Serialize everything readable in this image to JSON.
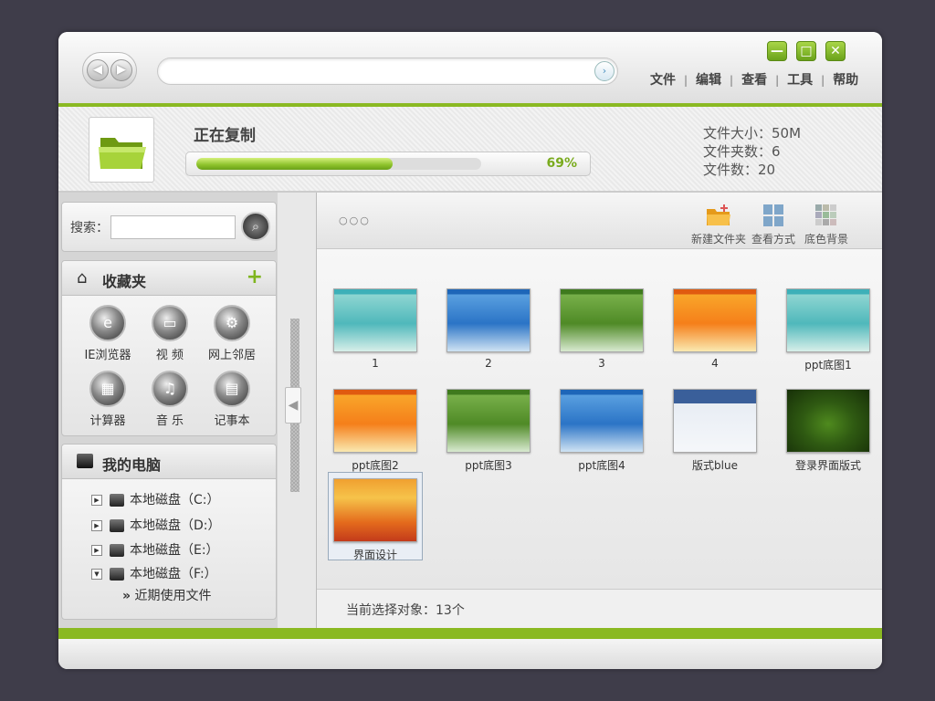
{
  "menu": {
    "file": "文件",
    "edit": "编辑",
    "view": "查看",
    "tools": "工具",
    "help": "帮助"
  },
  "window_controls": {
    "minimize": "—",
    "maximize": "□",
    "close": "✕"
  },
  "copy": {
    "title": "正在复制",
    "progress_pct": 0.69,
    "progress_label": "69%",
    "stats": {
      "size": "文件大小：50M",
      "folders": "文件夹数：6",
      "files": "文件数：20"
    }
  },
  "search": {
    "label": "搜索："
  },
  "favorites": {
    "title": "收藏夹",
    "items": [
      {
        "label": "IE浏览器",
        "icon": "ie-icon"
      },
      {
        "label": "视 频",
        "icon": "video-icon"
      },
      {
        "label": "网上邻居",
        "icon": "network-icon"
      },
      {
        "label": "计算器",
        "icon": "calculator-icon"
      },
      {
        "label": "音 乐",
        "icon": "music-icon"
      },
      {
        "label": "记事本",
        "icon": "notepad-icon"
      }
    ]
  },
  "computer": {
    "title": "我的电脑",
    "drives": [
      "本地磁盘（C:）",
      "本地磁盘（D:）",
      "本地磁盘（E:）",
      "本地磁盘（F:）"
    ],
    "recent": "近期使用文件"
  },
  "toolbar": {
    "new_folder": "新建文件夹",
    "view_mode": "查看方式",
    "bg_color": "底色背景"
  },
  "files": [
    {
      "name": "1",
      "theme": "teal"
    },
    {
      "name": "2",
      "theme": "blue"
    },
    {
      "name": "3",
      "theme": "green"
    },
    {
      "name": "4",
      "theme": "orange"
    },
    {
      "name": "ppt底图1",
      "theme": "teal"
    },
    {
      "name": "ppt底图2",
      "theme": "orange"
    },
    {
      "name": "ppt底图3",
      "theme": "green"
    },
    {
      "name": "ppt底图4",
      "theme": "blue"
    },
    {
      "name": "版式blue",
      "theme": "web"
    },
    {
      "name": "登录界面版式",
      "theme": "dark"
    },
    {
      "name": "界面设计",
      "theme": "ui"
    }
  ],
  "status": {
    "text": "当前选择对象：13个"
  },
  "colors": {
    "accent": "#8ab922",
    "window_bg": "#3f3d4a"
  }
}
